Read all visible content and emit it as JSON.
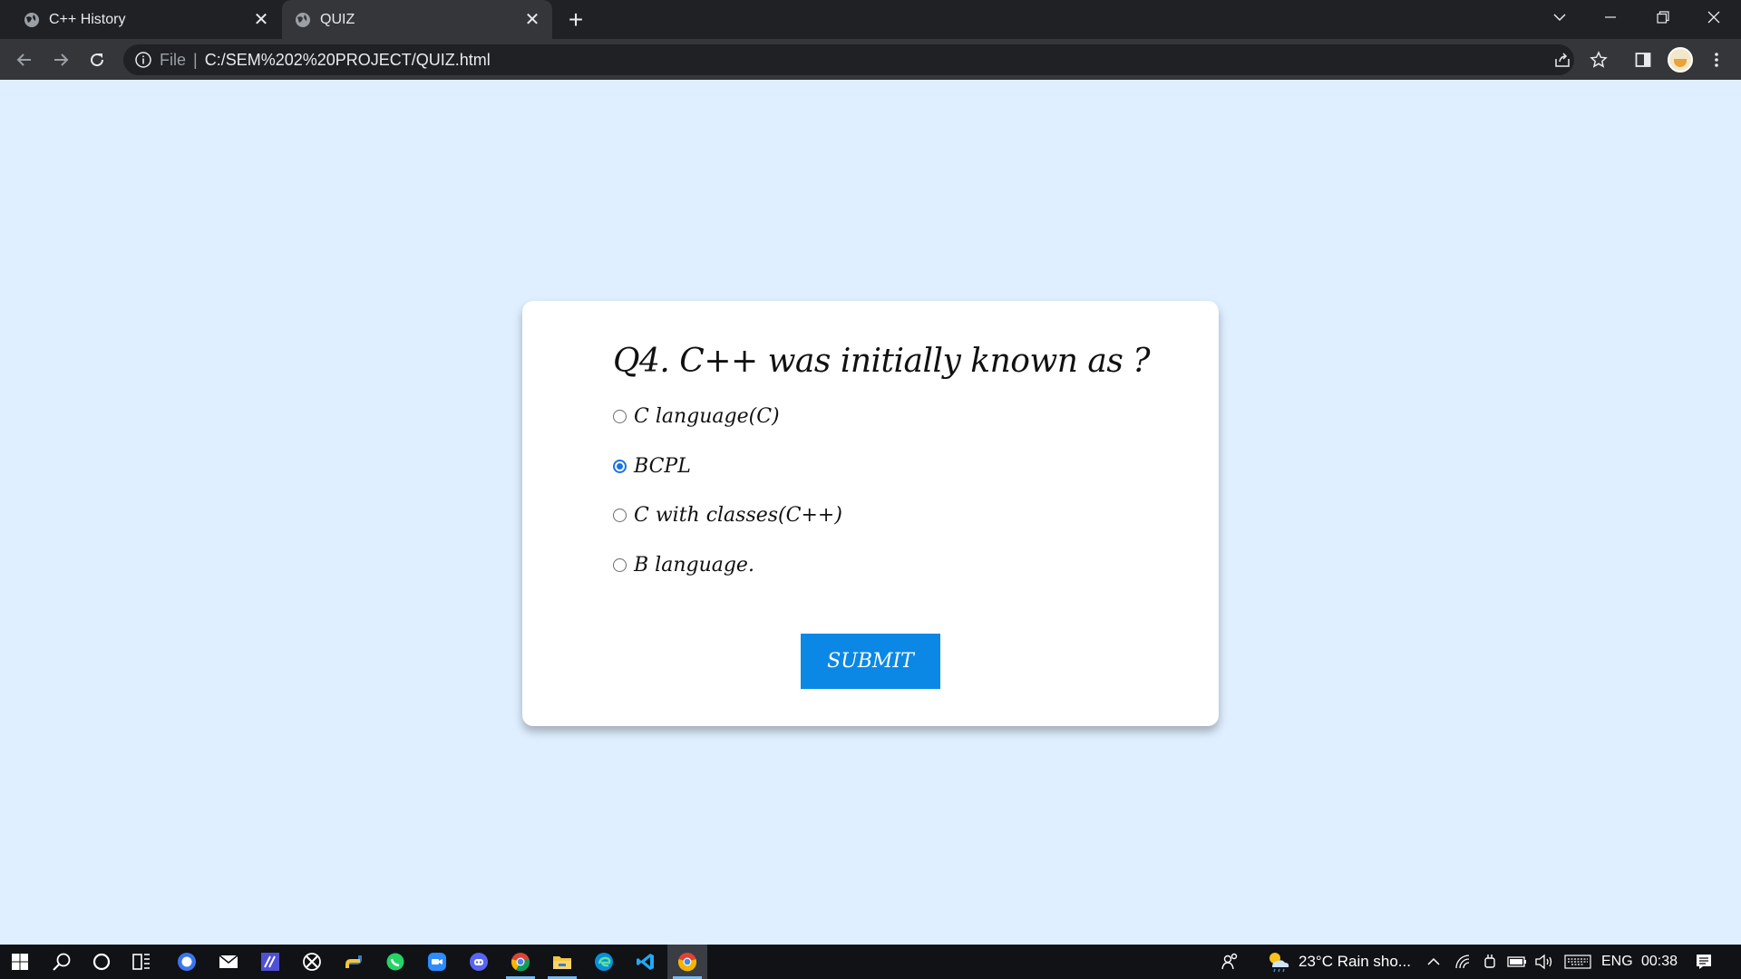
{
  "browser": {
    "tabs": [
      {
        "title": "C++ History",
        "active": false
      },
      {
        "title": "QUIZ",
        "active": true
      }
    ],
    "address": {
      "scheme_label": "File",
      "url": "C:/SEM%202%20PROJECT/QUIZ.html"
    },
    "colors": {
      "titlebar": "#202124",
      "toolbar": "#35363a"
    }
  },
  "quiz": {
    "question": "Q4. C++ was initially known as ?",
    "options": [
      {
        "label": "C language(C)",
        "selected": false
      },
      {
        "label": "BCPL",
        "selected": true
      },
      {
        "label": "C with classes(C++)",
        "selected": false
      },
      {
        "label": "B language.",
        "selected": false
      }
    ],
    "submit_label": "SUBMIT",
    "colors": {
      "page_bg": "#dfefff",
      "card_bg": "#ffffff",
      "button_bg": "#0b87e6"
    }
  },
  "taskbar": {
    "apps": [
      "start-icon",
      "search-icon",
      "cortana-icon",
      "task-view-icon",
      "signal-icon",
      "mail-icon",
      "sticky-app-icon",
      "xbox-icon",
      "python-icon",
      "whatsapp-icon",
      "zoom-icon",
      "discord-icon",
      "chrome-icon",
      "file-explorer-icon",
      "edge-icon",
      "vscode-icon",
      "chrome-active-icon"
    ],
    "weather": "23°C  Rain sho...",
    "language": "ENG",
    "time": "00:38"
  }
}
